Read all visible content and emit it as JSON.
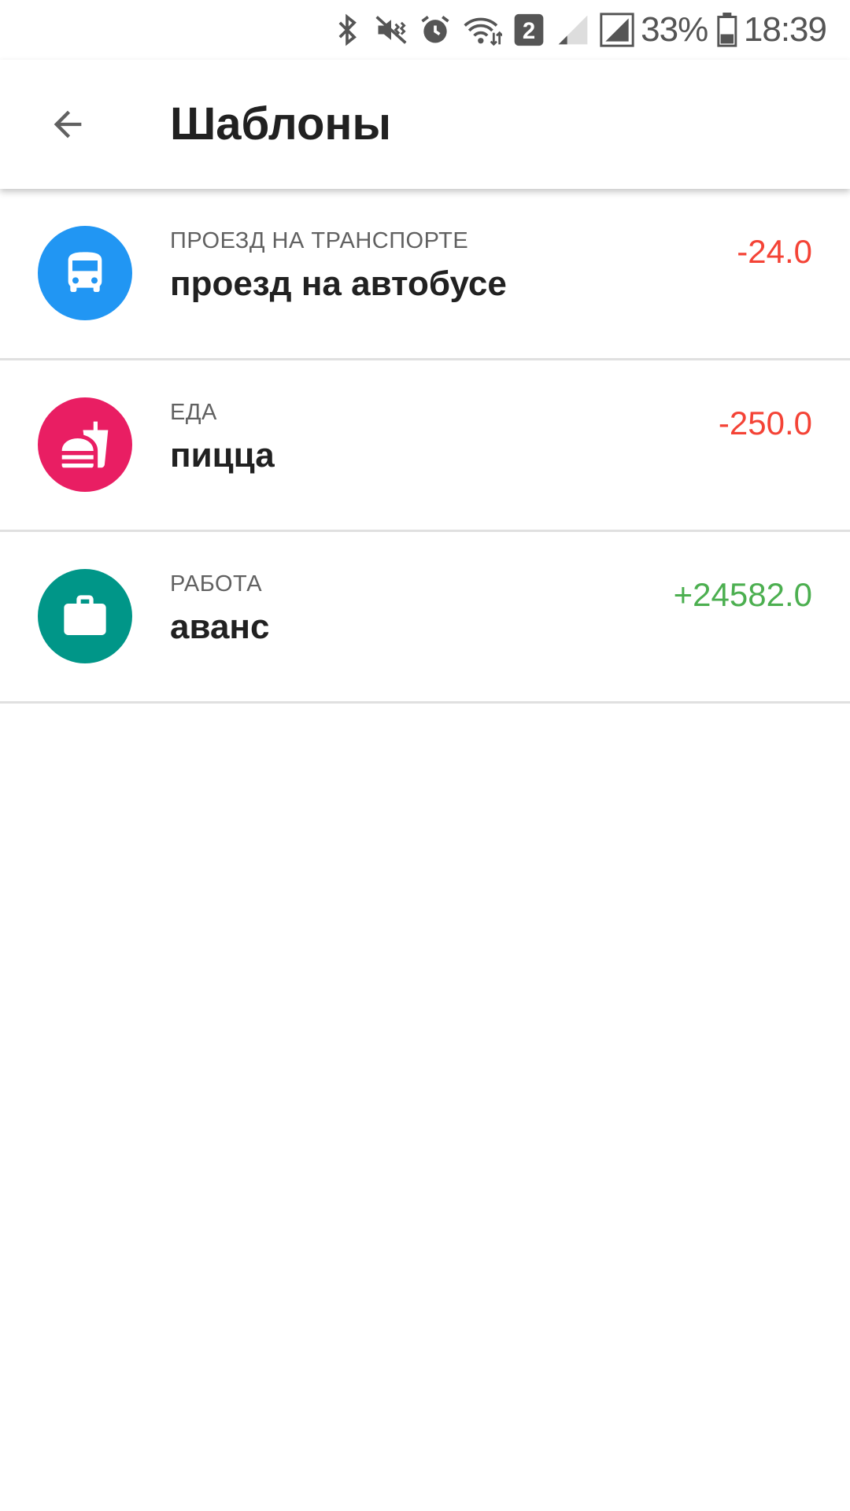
{
  "status_bar": {
    "battery": "33%",
    "time": "18:39",
    "sim_badge": "2",
    "icons": [
      "bluetooth-icon",
      "mute-vibrate-icon",
      "alarm-icon",
      "wifi-icon",
      "sim-badge",
      "signal-weak-icon",
      "signal-icon",
      "battery-icon"
    ]
  },
  "app_bar": {
    "title": "Шаблоны",
    "back_icon": "arrow-back-icon"
  },
  "templates": [
    {
      "category": "ПРОЕЗД НА ТРАНСПОРТЕ",
      "name": "проезд на автобусе",
      "amount": "-24.0",
      "icon": "bus-icon",
      "icon_color": "#2196F3",
      "amount_color": "#F44336"
    },
    {
      "category": "ЕДА",
      "name": "пицца",
      "amount": "-250.0",
      "icon": "fastfood-icon",
      "icon_color": "#E91E63",
      "amount_color": "#F44336"
    },
    {
      "category": "РАБОТА",
      "name": "аванс",
      "amount": "+24582.0",
      "icon": "briefcase-icon",
      "icon_color": "#009688",
      "amount_color": "#4CAF50"
    }
  ]
}
